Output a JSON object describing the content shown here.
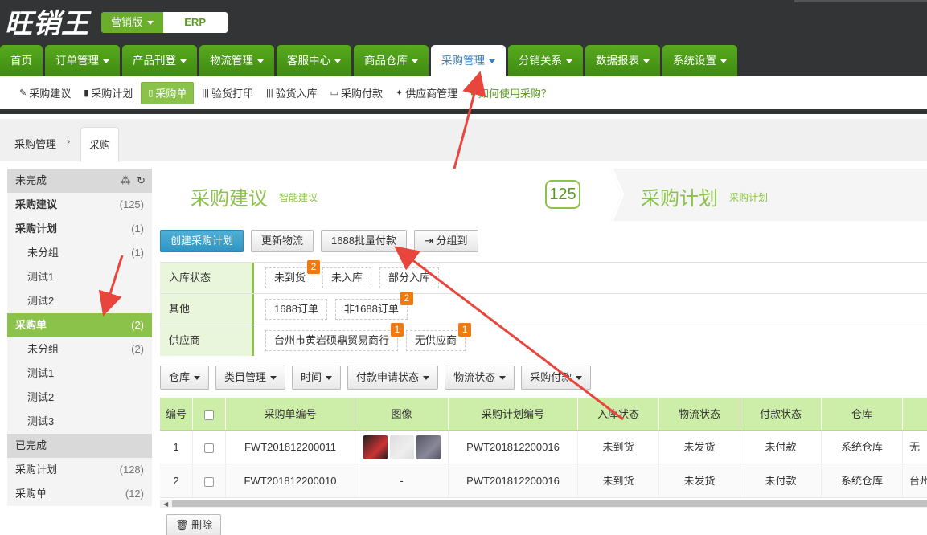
{
  "app": {
    "logo_text": "旺销王",
    "edition_label": "营销版",
    "edition_suffix": "ERP"
  },
  "main_nav": [
    {
      "label": "首页",
      "has_caret": false,
      "active": false
    },
    {
      "label": "订单管理",
      "has_caret": true,
      "active": false
    },
    {
      "label": "产品刊登",
      "has_caret": true,
      "active": false
    },
    {
      "label": "物流管理",
      "has_caret": true,
      "active": false
    },
    {
      "label": "客服中心",
      "has_caret": true,
      "active": false
    },
    {
      "label": "商品仓库",
      "has_caret": true,
      "active": false
    },
    {
      "label": "采购管理",
      "has_caret": true,
      "active": true
    },
    {
      "label": "分销关系",
      "has_caret": true,
      "active": false
    },
    {
      "label": "数据报表",
      "has_caret": true,
      "active": false
    },
    {
      "label": "系统设置",
      "has_caret": true,
      "active": false
    }
  ],
  "sub_nav": [
    {
      "icon": "magic-wand-icon",
      "glyph": "✎",
      "label": "采购建议"
    },
    {
      "icon": "book-icon",
      "glyph": "▮",
      "label": "采购计划"
    },
    {
      "icon": "file-icon",
      "glyph": "▯",
      "label": "采购单",
      "active": true
    },
    {
      "icon": "barcode-icon",
      "glyph": "|||",
      "label": "验货打印"
    },
    {
      "icon": "barcode-icon",
      "glyph": "|||",
      "label": "验货入库"
    },
    {
      "icon": "credit-card-icon",
      "glyph": "▭",
      "label": "采购付款"
    },
    {
      "icon": "users-icon",
      "glyph": "✦",
      "label": "供应商管理"
    },
    {
      "icon": "video-icon",
      "glyph": "■",
      "label": "如何使用采购？",
      "help": true
    }
  ],
  "breadcrumb": {
    "home": "采购管理",
    "separator": "›",
    "current_tab": "采购"
  },
  "sidebar": {
    "incomplete_header": "未完成",
    "incomplete_items": [
      {
        "label": "采购建议",
        "count": "(125)",
        "bold": true,
        "indent": false
      },
      {
        "label": "采购计划",
        "count": "(1)",
        "bold": true,
        "indent": false
      },
      {
        "label": "未分组",
        "count": "(1)",
        "bold": false,
        "indent": true
      },
      {
        "label": "测试1",
        "count": "",
        "bold": false,
        "indent": true
      },
      {
        "label": "测试2",
        "count": "",
        "bold": false,
        "indent": true
      },
      {
        "label": "采购单",
        "count": "(2)",
        "bold": true,
        "indent": false,
        "active": true
      },
      {
        "label": "未分组",
        "count": "(2)",
        "bold": false,
        "indent": true
      },
      {
        "label": "测试1",
        "count": "",
        "bold": false,
        "indent": true
      },
      {
        "label": "测试2",
        "count": "",
        "bold": false,
        "indent": true
      },
      {
        "label": "测试3",
        "count": "",
        "bold": false,
        "indent": true
      }
    ],
    "complete_header": "已完成",
    "complete_items": [
      {
        "label": "采购计划",
        "count": "(128)"
      },
      {
        "label": "采购单",
        "count": "(12)"
      }
    ]
  },
  "steps": {
    "step1_title": "采购建议",
    "step1_sub": "智能建议",
    "step1_count": "125",
    "step2_title": "采购计划",
    "step2_sub": "采购计划"
  },
  "buttons": {
    "create_plan": "创建采购计划",
    "update_logistics": "更新物流",
    "batch_pay": "1688批量付款",
    "group_to": "分组到",
    "delete": "删除"
  },
  "filters": [
    {
      "label": "入库状态",
      "items": [
        {
          "text": "未到货",
          "badge": "2"
        },
        {
          "text": "未入库",
          "badge": ""
        },
        {
          "text": "部分入库",
          "badge": ""
        }
      ]
    },
    {
      "label": "其他",
      "items": [
        {
          "text": "1688订单",
          "badge": ""
        },
        {
          "text": "非1688订单",
          "badge": "2"
        }
      ]
    },
    {
      "label": "供应商",
      "items": [
        {
          "text": "台州市黄岩硕鼎贸易商行",
          "badge": "1"
        },
        {
          "text": "无供应商",
          "badge": "1"
        }
      ]
    }
  ],
  "dropdowns": [
    "仓库",
    "类目管理",
    "时间",
    "付款申请状态",
    "物流状态",
    "采购付款"
  ],
  "table": {
    "headers": {
      "no": "编号",
      "code": "采购单编号",
      "image": "图像",
      "plan": "采购计划编号",
      "inbound": "入库状态",
      "logistics": "物流状态",
      "payment": "付款状态",
      "warehouse": "仓库"
    },
    "rows": [
      {
        "no": "1",
        "code": "FWT201812200011",
        "image": "thumbs",
        "plan": "PWT201812200016",
        "inbound": "未到货",
        "logistics": "未发货",
        "payment": "未付款",
        "warehouse": "系统仓库",
        "more": "无"
      },
      {
        "no": "2",
        "code": "FWT201812200010",
        "image": "-",
        "plan": "PWT201812200016",
        "inbound": "未到货",
        "logistics": "未发货",
        "payment": "未付款",
        "warehouse": "系统仓库",
        "more": "台州"
      }
    ]
  },
  "colors": {
    "nav_green": "#4a9a18",
    "active_green": "#8bc34a",
    "header_dark": "#333435",
    "badge_orange": "#f07a0f",
    "arrow_red": "#e8453c",
    "primary_blue": "#3a9fd0"
  }
}
